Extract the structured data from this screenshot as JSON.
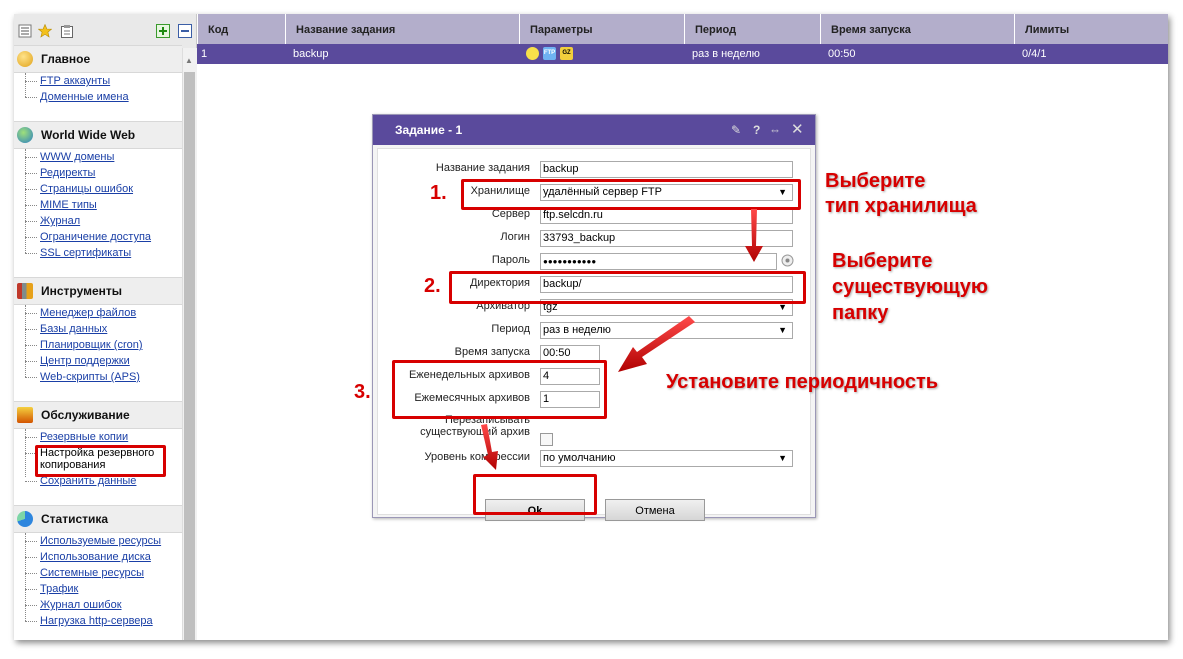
{
  "sidebar": {
    "toolbar_icons": [
      "list-icon",
      "star-icon",
      "clipboard-icon",
      "expand-plus-icon",
      "collapse-minus-icon"
    ],
    "sections": [
      {
        "title": "Главное",
        "icon": "home-icon",
        "links": [
          "FTP аккаунты",
          "Доменные имена"
        ]
      },
      {
        "title": "World Wide Web",
        "icon": "globe-icon",
        "links": [
          "WWW домены",
          "Редиректы",
          "Страницы ошибок",
          "MIME типы",
          "Журнал",
          "Ограничение доступа",
          "SSL сертификаты"
        ]
      },
      {
        "title": "Инструменты",
        "icon": "tools-icon",
        "links": [
          "Менеджер файлов",
          "Базы данных",
          "Планировщик (cron)",
          "Центр поддержки",
          "Web-скрипты (APS)"
        ]
      },
      {
        "title": "Обслуживание",
        "icon": "maintenance-icon",
        "links": [
          "Резервные копии",
          "Настройка резервного копирования",
          "Сохранить данные"
        ]
      },
      {
        "title": "Статистика",
        "icon": "stats-icon",
        "links": [
          "Используемые ресурсы",
          "Использование диска",
          "Системные ресурсы",
          "Трафик",
          "Журнал ошибок",
          "Нагрузка http-сервера"
        ]
      }
    ]
  },
  "table": {
    "columns": [
      "Код",
      "Название задания",
      "Параметры",
      "Период",
      "Время запуска",
      "Лимиты"
    ],
    "rows": [
      {
        "code": "1",
        "name": "backup",
        "params_icons": [
          "lightbulb-icon",
          "ftp-icon",
          "gz-icon"
        ],
        "params_badges": [
          "FTP",
          "GZ"
        ],
        "period": "раз в неделю",
        "time": "00:50",
        "limits": "0/4/1"
      }
    ]
  },
  "dialog": {
    "title": "Задание - 1",
    "controls": [
      "pin-icon",
      "help-icon",
      "resize-icon",
      "close-icon"
    ],
    "fields": {
      "task_name": {
        "label": "Название задания",
        "value": "backup"
      },
      "storage": {
        "label": "Хранилище",
        "value": "удалённый сервер FTP"
      },
      "server": {
        "label": "Сервер",
        "value": "ftp.selcdn.ru"
      },
      "login": {
        "label": "Логин",
        "value": "33793_backup"
      },
      "password": {
        "label": "Пароль",
        "value": "●●●●●●●●●●●"
      },
      "directory": {
        "label": "Директория",
        "value": "backup/"
      },
      "archiver": {
        "label": "Архиватор",
        "value": "tgz"
      },
      "period": {
        "label": "Период",
        "value": "раз в неделю"
      },
      "start_time": {
        "label": "Время запуска",
        "value": "00:50"
      },
      "weekly": {
        "label": "Еженедельных архивов",
        "value": "4"
      },
      "monthly": {
        "label": "Ежемесячных архивов",
        "value": "1"
      },
      "overwrite": {
        "label_line1": "Перезаписывать",
        "label_line2": "существующий архив",
        "checked": false
      },
      "compression": {
        "label": "Уровень компрессии",
        "value": "по умолчанию"
      }
    },
    "buttons": {
      "ok": "Ok",
      "cancel": "Отмена"
    }
  },
  "annotations": {
    "num1": "1.",
    "num2": "2.",
    "num3": "3.",
    "text1_line1": "Выберите",
    "text1_line2": "тип хранилища",
    "text2_line1": "Выберите",
    "text2_line2": "существующую",
    "text2_line3": "папку",
    "text3": "Установите периодичность"
  },
  "colors": {
    "accent_purple": "#5a4a9c",
    "header_lavender": "#b3aecb",
    "annotation_red": "#d70000",
    "link_blue": "#1a3fa6"
  }
}
